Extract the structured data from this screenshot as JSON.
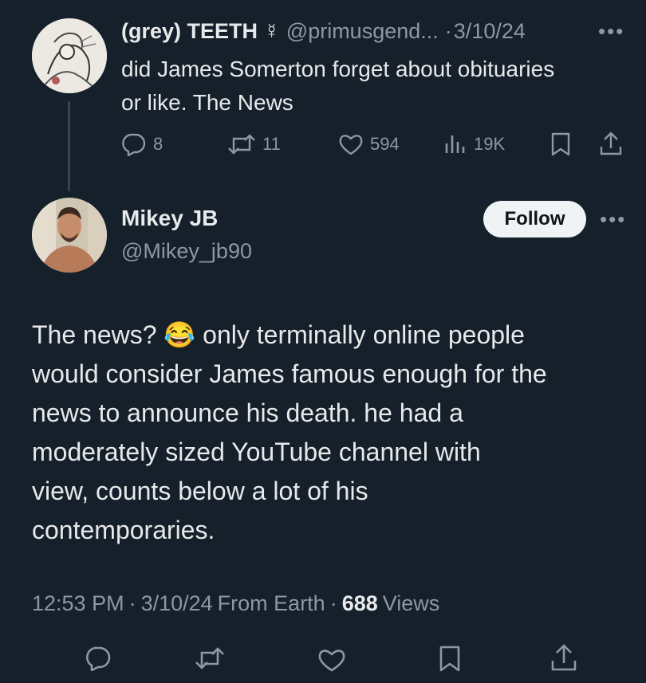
{
  "parent_tweet": {
    "display_name": "(grey) TEETH ☿",
    "handle": "@primusgend...",
    "dot": "·",
    "date": "3/10/24",
    "text_line1": "did James Somerton forget about obituaries",
    "text_line2": "or like. The News",
    "replies": "8",
    "retweets": "11",
    "likes": "594",
    "views": "19K"
  },
  "main_tweet": {
    "display_name": "Mikey JB",
    "handle": "@Mikey_jb90",
    "follow_label": "Follow",
    "text_lines": [
      "The news? 😂 only terminally online people",
      "would consider James famous enough for the",
      "news to announce his death. he had a",
      "moderately sized YouTube channel with",
      "view, counts below a lot of his",
      "contemporaries."
    ],
    "meta": {
      "time": "12:53 PM",
      "sep1": "·",
      "date": "3/10/24",
      "source": "From Earth",
      "sep2": "·",
      "views_count": "688",
      "views_label": "Views"
    }
  },
  "icons": {
    "more": "more-icon",
    "reply": "reply-icon",
    "retweet": "retweet-icon",
    "like": "heart-icon",
    "views": "views-chart-icon",
    "bookmark": "bookmark-icon",
    "share": "share-icon"
  },
  "colors": {
    "background": "#15202b",
    "text": "#e7e9ea",
    "muted": "#8b98a5",
    "follow_bg": "#eff3f4"
  }
}
